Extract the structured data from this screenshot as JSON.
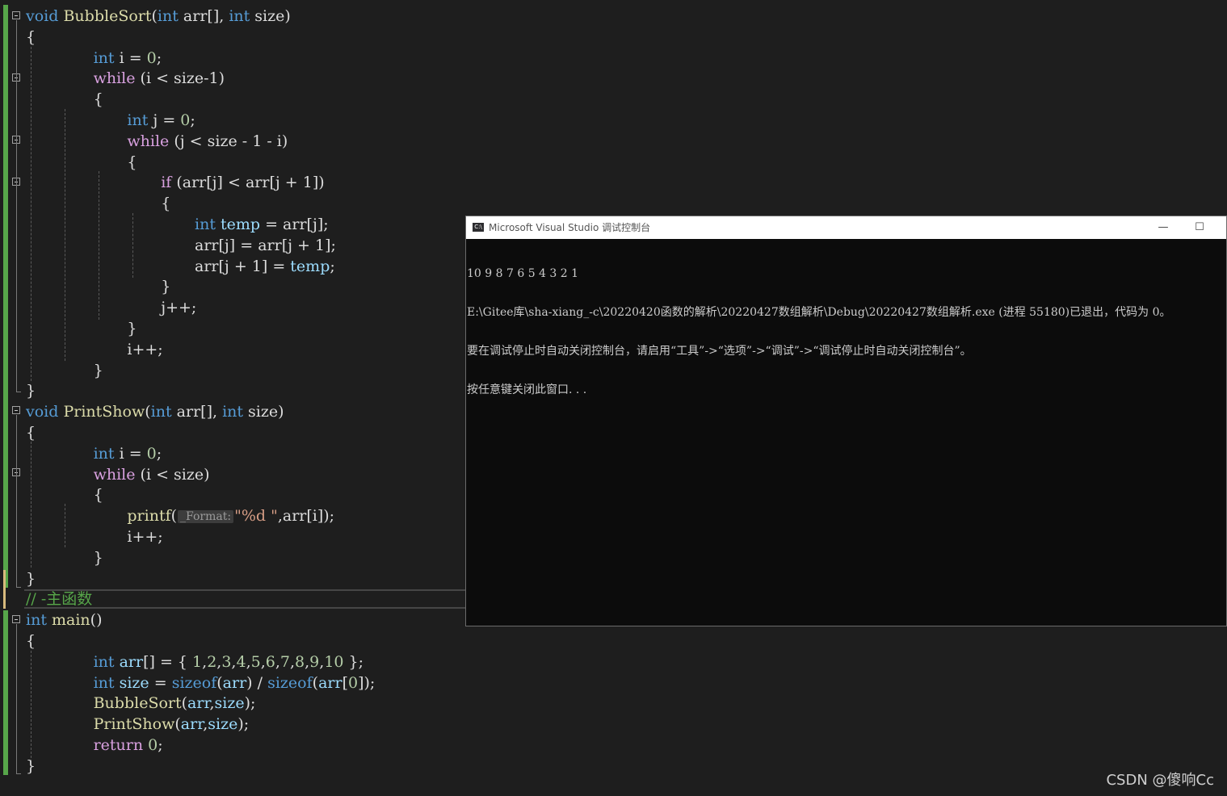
{
  "editor": {
    "lines": [
      [
        {
          "t": "void",
          "c": "kw"
        },
        {
          "t": " "
        },
        {
          "t": "BubbleSort",
          "c": "fn"
        },
        {
          "t": "("
        },
        {
          "t": "int",
          "c": "kw"
        },
        {
          "t": " arr[], "
        },
        {
          "t": "int",
          "c": "kw"
        },
        {
          "t": " size)"
        }
      ],
      [
        {
          "t": "{"
        }
      ],
      [
        {
          "t": "int",
          "c": "kw"
        },
        {
          "t": " i = "
        },
        {
          "t": "0",
          "c": "num"
        },
        {
          "t": ";"
        }
      ],
      [
        {
          "t": "while",
          "c": "ctl"
        },
        {
          "t": " (i < size-1)"
        }
      ],
      [
        {
          "t": "{"
        }
      ],
      [
        {
          "t": "int",
          "c": "kw"
        },
        {
          "t": " j = "
        },
        {
          "t": "0",
          "c": "num"
        },
        {
          "t": ";"
        }
      ],
      [
        {
          "t": "while",
          "c": "ctl"
        },
        {
          "t": " (j < size - 1 - i)"
        }
      ],
      [
        {
          "t": "{"
        }
      ],
      [
        {
          "t": "if",
          "c": "ctl"
        },
        {
          "t": " (arr[j] < arr[j + 1])"
        }
      ],
      [
        {
          "t": "{"
        }
      ],
      [
        {
          "t": "int",
          "c": "kw"
        },
        {
          "t": " "
        },
        {
          "t": "temp",
          "c": "var"
        },
        {
          "t": " = arr[j];"
        }
      ],
      [
        {
          "t": "arr[j] = arr[j + 1];"
        }
      ],
      [
        {
          "t": "arr[j + 1] = "
        },
        {
          "t": "temp",
          "c": "var"
        },
        {
          "t": ";"
        }
      ],
      [
        {
          "t": "}"
        }
      ],
      [
        {
          "t": "j++;"
        }
      ],
      [
        {
          "t": "}"
        }
      ],
      [
        {
          "t": "i++;"
        }
      ],
      [
        {
          "t": "}"
        }
      ],
      [
        {
          "t": "}"
        }
      ],
      [
        {
          "t": "void",
          "c": "kw"
        },
        {
          "t": " "
        },
        {
          "t": "PrintShow",
          "c": "fn"
        },
        {
          "t": "("
        },
        {
          "t": "int",
          "c": "kw"
        },
        {
          "t": " arr[], "
        },
        {
          "t": "int",
          "c": "kw"
        },
        {
          "t": " size)"
        }
      ],
      [
        {
          "t": "{"
        }
      ],
      [
        {
          "t": "int",
          "c": "kw"
        },
        {
          "t": " i = "
        },
        {
          "t": "0",
          "c": "num"
        },
        {
          "t": ";"
        }
      ],
      [
        {
          "t": "while",
          "c": "ctl"
        },
        {
          "t": " (i < size)"
        }
      ],
      [
        {
          "t": "{"
        }
      ],
      [
        {
          "t": "printf",
          "c": "fn"
        },
        {
          "t": "("
        },
        {
          "t": "_Format:",
          "c": "hint"
        },
        {
          "t": "\"%d \"",
          "c": "str"
        },
        {
          "t": ",arr[i]);"
        }
      ],
      [
        {
          "t": "i++;"
        }
      ],
      [
        {
          "t": "}"
        }
      ],
      [
        {
          "t": "}"
        }
      ],
      [
        {
          "t": "// -主函数",
          "c": "cmt"
        }
      ],
      [
        {
          "t": "int",
          "c": "kw"
        },
        {
          "t": " "
        },
        {
          "t": "main",
          "c": "fn"
        },
        {
          "t": "()"
        }
      ],
      [
        {
          "t": "{"
        }
      ],
      [
        {
          "t": "int",
          "c": "kw"
        },
        {
          "t": " "
        },
        {
          "t": "arr",
          "c": "var"
        },
        {
          "t": "[] = { "
        },
        {
          "t": "1",
          "c": "num"
        },
        {
          "t": ","
        },
        {
          "t": "2",
          "c": "num"
        },
        {
          "t": ","
        },
        {
          "t": "3",
          "c": "num"
        },
        {
          "t": ","
        },
        {
          "t": "4",
          "c": "num"
        },
        {
          "t": ","
        },
        {
          "t": "5",
          "c": "num"
        },
        {
          "t": ","
        },
        {
          "t": "6",
          "c": "num"
        },
        {
          "t": ","
        },
        {
          "t": "7",
          "c": "num"
        },
        {
          "t": ","
        },
        {
          "t": "8",
          "c": "num"
        },
        {
          "t": ","
        },
        {
          "t": "9",
          "c": "num"
        },
        {
          "t": ","
        },
        {
          "t": "10",
          "c": "num"
        },
        {
          "t": " };"
        }
      ],
      [
        {
          "t": "int",
          "c": "kw"
        },
        {
          "t": " "
        },
        {
          "t": "size",
          "c": "var"
        },
        {
          "t": " = "
        },
        {
          "t": "sizeof",
          "c": "kw"
        },
        {
          "t": "("
        },
        {
          "t": "arr",
          "c": "var"
        },
        {
          "t": ") / "
        },
        {
          "t": "sizeof",
          "c": "kw"
        },
        {
          "t": "("
        },
        {
          "t": "arr",
          "c": "var"
        },
        {
          "t": "["
        },
        {
          "t": "0",
          "c": "num"
        },
        {
          "t": "]);"
        }
      ],
      [
        {
          "t": "BubbleSort",
          "c": "fn"
        },
        {
          "t": "("
        },
        {
          "t": "arr",
          "c": "var"
        },
        {
          "t": ","
        },
        {
          "t": "size",
          "c": "var"
        },
        {
          "t": ");"
        }
      ],
      [
        {
          "t": "PrintShow",
          "c": "fn"
        },
        {
          "t": "("
        },
        {
          "t": "arr",
          "c": "var"
        },
        {
          "t": ","
        },
        {
          "t": "size",
          "c": "var"
        },
        {
          "t": ");"
        }
      ],
      [
        {
          "t": "return",
          "c": "ctl"
        },
        {
          "t": " "
        },
        {
          "t": "0",
          "c": "num"
        },
        {
          "t": ";"
        }
      ],
      [
        {
          "t": "}"
        }
      ]
    ]
  },
  "console": {
    "icon_label": "C:\\",
    "title": "Microsoft Visual Studio 调试控制台",
    "minimize_glyph": "—",
    "maximize_glyph": "☐",
    "output_lines": [
      "10 9 8 7 6 5 4 3 2 1",
      "E:\\Gitee库\\sha-xiang_-c\\20220420函数的解析\\20220427数组解析\\Debug\\20220427数组解析.exe (进程 55180)已退出，代码为 0。",
      "要在调试停止时自动关闭控制台，请启用“工具”->“选项”->“调试”->“调试停止时自动关闭控制台”。",
      "按任意键关闭此窗口. . ."
    ]
  },
  "watermark": "CSDN @傻响Cc"
}
